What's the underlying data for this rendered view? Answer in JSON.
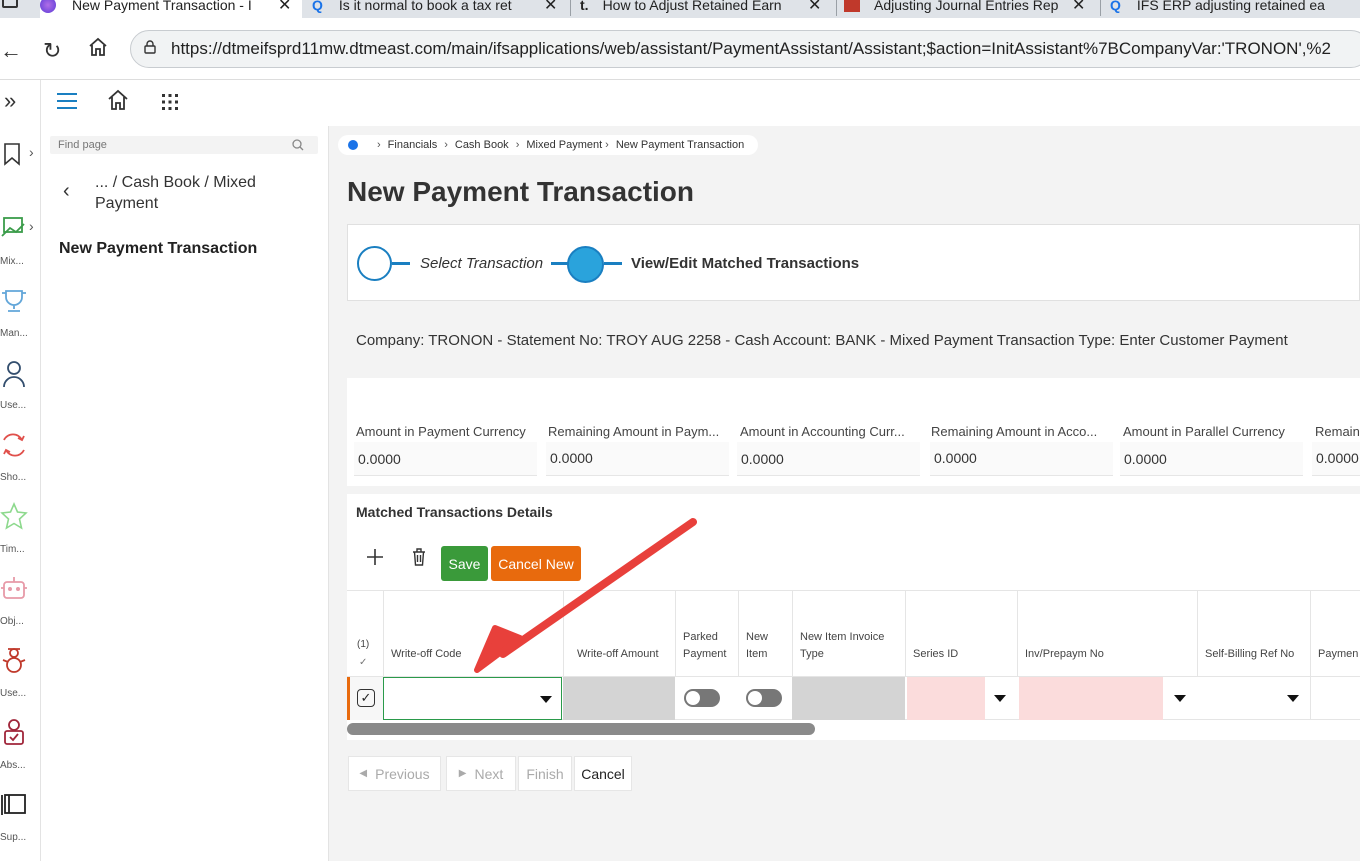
{
  "browser": {
    "tabs": [
      {
        "title": "New Payment Transaction - I"
      },
      {
        "title": "Is it normal to book a tax ret"
      },
      {
        "title": "How to Adjust Retained Earn"
      },
      {
        "title": "Adjusting Journal Entries Rep"
      },
      {
        "title": "IFS ERP adjusting retained ea"
      }
    ],
    "url": "https://dtmeifsprd11mw.dtmeast.com/main/ifsapplications/web/assistant/PaymentAssistant/Assistant;$action=InitAssistant%7BCompanyVar:'TRONON',%2"
  },
  "rail": {
    "items": [
      {
        "label": "Mix...",
        "icon": "payment-icon"
      },
      {
        "label": "Man...",
        "icon": "trophy-icon"
      },
      {
        "label": "Use...",
        "icon": "user-icon"
      },
      {
        "label": "Sho...",
        "icon": "shuffle-icon"
      },
      {
        "label": "Tim...",
        "icon": "star-icon"
      },
      {
        "label": "Obj...",
        "icon": "robot-icon"
      },
      {
        "label": "Use...",
        "icon": "snowman-icon"
      },
      {
        "label": "Abs...",
        "icon": "person-badge-icon"
      },
      {
        "label": "Sup...",
        "icon": "panel-icon"
      }
    ]
  },
  "nav": {
    "find_placeholder": "Find page",
    "back_path": "... / Cash Book / Mixed Payment",
    "current_page": "New Payment Transaction"
  },
  "breadcrumb": [
    "Financials",
    "Cash Book",
    "Mixed Payment",
    "New Payment Transaction"
  ],
  "page": {
    "title": "New Payment Transaction",
    "steps": [
      {
        "label": "Select Transaction",
        "state": "done"
      },
      {
        "label": "View/Edit Matched Transactions",
        "state": "current"
      }
    ],
    "info": "Company: TRONON - Statement No: TROY AUG 2258 - Cash Account: BANK - Mixed Payment Transaction Type: Enter Customer Payment"
  },
  "amounts": [
    {
      "label": "Amount in Payment Currency",
      "value": "0.0000"
    },
    {
      "label": "Remaining Amount in Paym...",
      "value": "0.0000"
    },
    {
      "label": "Amount in Accounting Curr...",
      "value": "0.0000"
    },
    {
      "label": "Remaining Amount in Acco...",
      "value": "0.0000"
    },
    {
      "label": "Amount in Parallel Currency",
      "value": "0.0000"
    },
    {
      "label": "Remain",
      "value": "0.0000"
    }
  ],
  "details": {
    "title": "Matched Transactions Details",
    "save_label": "Save",
    "cancel_new_label": "Cancel New",
    "selection_count": "(1)",
    "columns": [
      "Write-off Code",
      "Write-off Amount",
      "Parked Payment",
      "New Item",
      "New Item Invoice Type",
      "Series ID",
      "Inv/Prepaym No",
      "Self-Billing Ref No",
      "Paymen"
    ]
  },
  "wizard": {
    "previous_label": "Previous",
    "next_label": "Next",
    "finish_label": "Finish",
    "cancel_label": "Cancel"
  },
  "colors": {
    "primary": "#1a7fc1",
    "save": "#3a9a3a",
    "cancel_new": "#e86a0d",
    "required_field": "#fbdcdc",
    "annotation_arrow": "#e8403b"
  }
}
